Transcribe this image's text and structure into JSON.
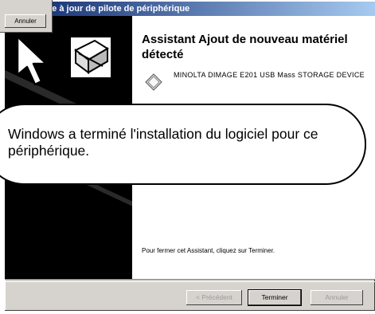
{
  "window": {
    "title": "ise à jour de pilote de périphérique"
  },
  "wizard": {
    "heading": "Assistant Ajout de nouveau matériel détecté",
    "device_name": "MINOLTA DIMAGE E201 USB Mass STORAGE DEVICE",
    "footer": "Pour fermer cet Assistant, cliquez sur Terminer."
  },
  "buttons": {
    "back": "< Précédent",
    "finish": "Terminer",
    "cancel": "Annuler"
  },
  "overlay": {
    "callout": "Windows a terminé l'installation du logiciel pour ce périphérique.",
    "top_button": "Annuler"
  },
  "icons": {
    "wizard": "hardware-wizard-icon",
    "device": "device-diamond-icon",
    "cursor": "mouse-pointer-icon"
  }
}
